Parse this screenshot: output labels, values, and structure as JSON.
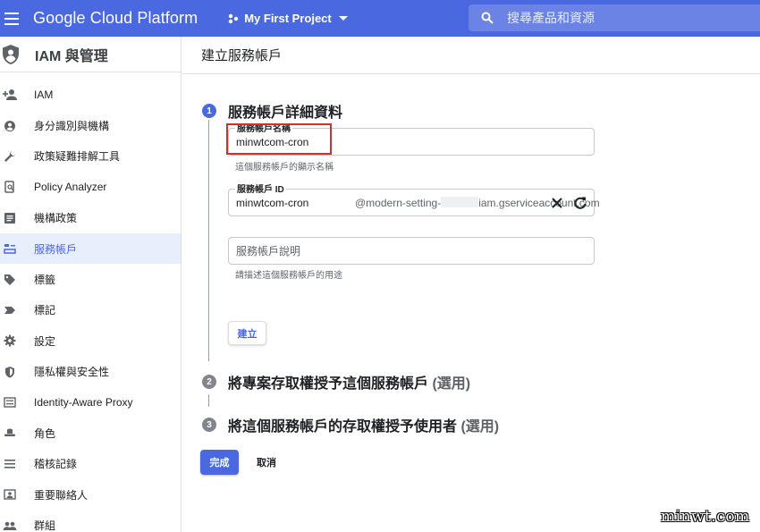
{
  "topbar": {
    "brand": "Google Cloud Platform",
    "project": "My First Project",
    "search_placeholder": "搜尋產品和資源"
  },
  "sidebar": {
    "title": "IAM 與管理",
    "items": [
      {
        "label": "IAM",
        "icon": "person-add-icon"
      },
      {
        "label": "身分識別與機構",
        "icon": "account-circle-icon"
      },
      {
        "label": "政策疑難排解工具",
        "icon": "wrench-icon"
      },
      {
        "label": "Policy Analyzer",
        "icon": "policy-search-icon"
      },
      {
        "label": "機構政策",
        "icon": "list-doc-icon"
      },
      {
        "label": "服務帳戶",
        "icon": "service-account-icon",
        "active": true
      },
      {
        "label": "標籤",
        "icon": "tag-icon"
      },
      {
        "label": "標記",
        "icon": "label-icon"
      },
      {
        "label": "設定",
        "icon": "gear-icon"
      },
      {
        "label": "隱私權與安全性",
        "icon": "shield-icon"
      },
      {
        "label": "Identity-Aware Proxy",
        "icon": "proxy-icon"
      },
      {
        "label": "角色",
        "icon": "hat-icon"
      },
      {
        "label": "稽核記錄",
        "icon": "lines-icon"
      },
      {
        "label": "重要聯絡人",
        "icon": "contact-icon"
      },
      {
        "label": "群組",
        "icon": "group-icon"
      }
    ]
  },
  "main": {
    "page_title": "建立服務帳戶",
    "step1": {
      "num": "1",
      "title": "服務帳戶詳細資料"
    },
    "name_field": {
      "label": "服務帳戶名稱",
      "value": "minwtcom-cron",
      "hint": "這個服務帳戶的顯示名稱"
    },
    "id_field": {
      "label": "服務帳戶 ID",
      "value": "minwtcom-cron",
      "suffix_start": "@modern-setting-",
      "suffix_end": "iam.gserviceaccount.com"
    },
    "desc_field": {
      "placeholder": "服務帳戶說明",
      "hint": "請描述這個服務帳戶的用途"
    },
    "create_label": "建立",
    "step2": {
      "num": "2",
      "title": "將專案存取權授予這個服務帳戶",
      "optional": "(選用)"
    },
    "step3": {
      "num": "3",
      "title": "將這個服務帳戶的存取權授予使用者",
      "optional": "(選用)"
    },
    "done_label": "完成",
    "cancel_label": "取消"
  },
  "watermark": "minwt.com",
  "colors": {
    "accent": "#4a68df",
    "highlight_box": "#d32f2f"
  }
}
